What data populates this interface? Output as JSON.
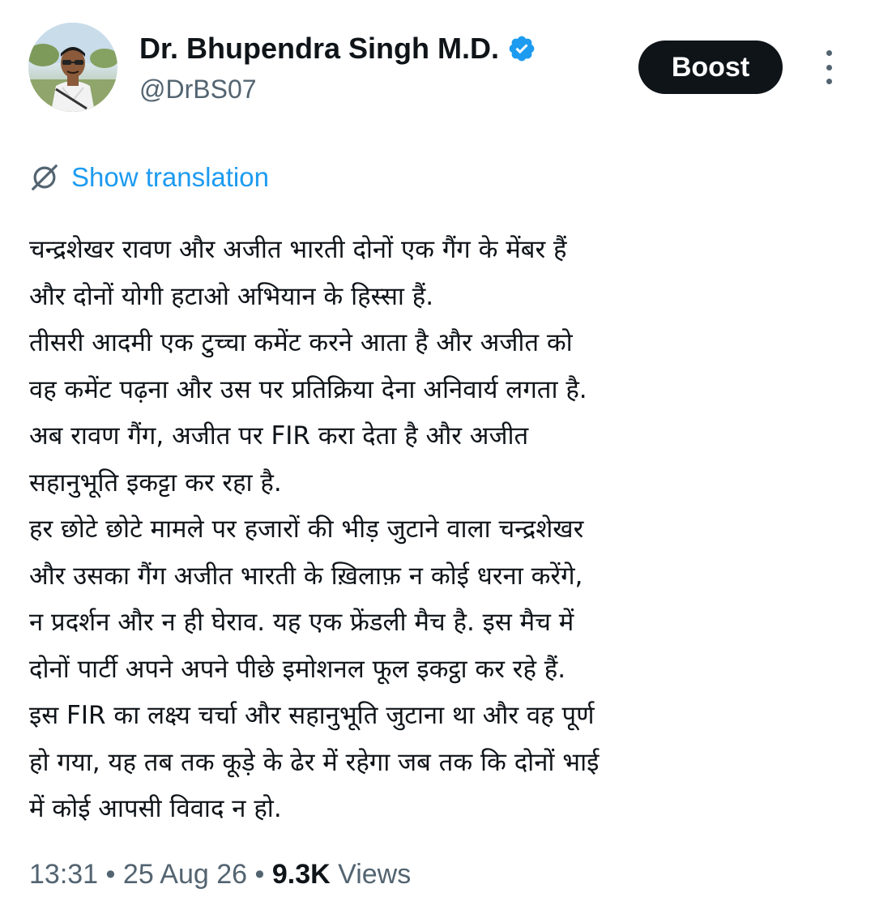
{
  "author": {
    "display_name": "Dr. Bhupendra Singh M.D.",
    "handle": "@DrBS07",
    "verified_badge_color": "#1d9bf0",
    "avatar_icon": "profile-photo"
  },
  "actions": {
    "boost_label": "Boost",
    "more_icon": "vertical-ellipsis-icon"
  },
  "translation": {
    "icon": "globe-slash-icon",
    "label": "Show translation"
  },
  "post": {
    "lines": [
      "चन्द्रशेखर रावण और अजीत भारती दोनों एक गैंग के मेंबर हैं",
      "और दोनों योगी हटाओ अभियान के हिस्सा हैं.",
      "तीसरी आदमी एक टुच्चा कमेंट करने आता है और अजीत को",
      "वह कमेंट पढ़ना और उस पर प्रतिक्रिया देना अनिवार्य लगता है.",
      "अब रावण गैंग, अजीत पर FIR करा देता है और अजीत",
      "सहानुभूति इकट्टा कर रहा है.",
      "हर छोटे छोटे मामले पर हजारों की भीड़ जुटाने वाला चन्द्रशेखर",
      "और उसका गैंग अजीत भारती के ख़िलाफ़ न कोई धरना करेंगे,",
      "न प्रदर्शन और न ही घेराव. यह एक फ्रेंडली मैच है. इस मैच में",
      "दोनों पार्टी अपने अपने पीछे इमोशनल फूल इकट्ठा कर रहे हैं.",
      "इस FIR का लक्ष्य चर्चा और सहानुभूति जुटाना था और वह पूर्ण",
      "हो गया, यह तब तक कूड़े के ढेर में रहेगा जब तक कि दोनों भाई",
      "में कोई आपसी विवाद न हो."
    ]
  },
  "meta": {
    "time": "13:31",
    "separator": "•",
    "date": "25 Aug 26",
    "views_count": "9.3K",
    "views_label": "Views"
  },
  "colors": {
    "text_primary": "#0f1419",
    "text_secondary": "#536471",
    "link": "#1d9bf0",
    "button_bg": "#0f1419",
    "button_text": "#ffffff"
  }
}
